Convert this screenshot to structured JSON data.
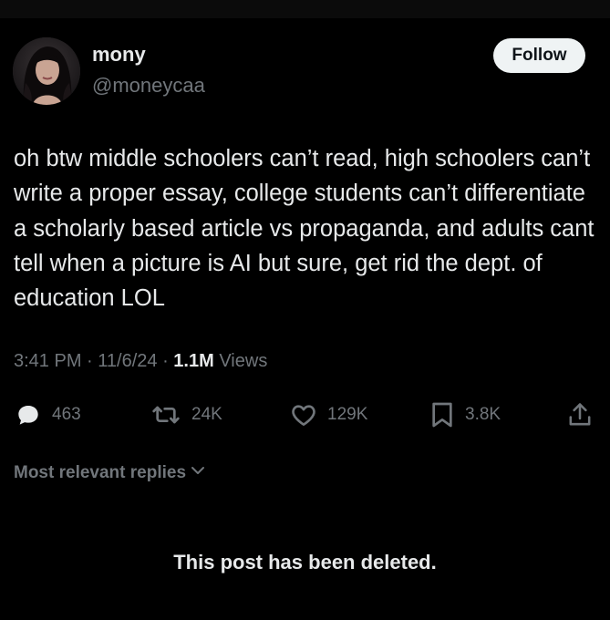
{
  "author": {
    "name": "mony",
    "handle": "@moneycaa",
    "follow_label": "Follow"
  },
  "post": {
    "text": "oh btw middle schoolers can’t read, high schoolers can’t write a proper essay, college students can’t differentiate a scholarly based article vs propaganda, and adults cant tell when a picture is AI but sure, get rid the dept. of education LOL",
    "time": "3:41 PM",
    "date": "11/6/24",
    "views_count": "1.1M",
    "views_label": "Views"
  },
  "actions": {
    "replies": "463",
    "reposts": "24K",
    "likes": "129K",
    "bookmarks": "3.8K"
  },
  "replies_filter": "Most relevant replies",
  "deleted_notice": "This post has been deleted.",
  "icons": {
    "reply": "reply-icon",
    "repost": "repost-icon",
    "like": "heart-icon",
    "bookmark": "bookmark-icon",
    "share": "share-icon",
    "chevron": "chevron-down-icon"
  },
  "colors": {
    "background": "#000000",
    "text_primary": "#e7e9ea",
    "text_secondary": "#71767b",
    "follow_button_bg": "#eff3f4"
  }
}
